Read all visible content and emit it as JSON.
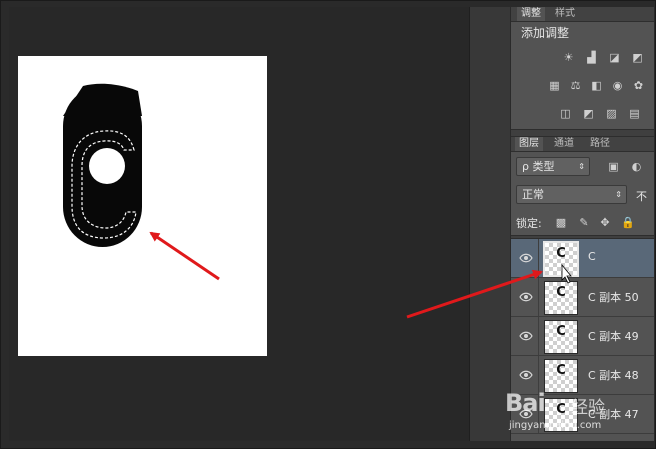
{
  "panels": {
    "adjust_tabs": [
      "调整",
      "样式"
    ],
    "adjust_title": "添加调整",
    "adjust_icons": [
      "brightness-icon",
      "levels-icon",
      "curves-icon",
      "exposure-icon",
      "vibrance-icon",
      "color-balance-icon",
      "black-white-icon",
      "photo-filter-icon",
      "channel-mixer-icon",
      "color-lookup-icon",
      "invert-icon",
      "posterize-icon",
      "threshold-icon",
      "gradient-map-icon"
    ],
    "layer_tabs": [
      "图层",
      "通道",
      "路径"
    ],
    "filter_label": "ρ 类型",
    "blend_mode": "正常",
    "opacity_label": "不",
    "lock_label": "锁定:",
    "lock_icons": [
      "lock-transparent-icon",
      "lock-paint-icon",
      "lock-move-icon",
      "lock-all-icon"
    ]
  },
  "layers": [
    {
      "name": "C",
      "thumb": "C",
      "selected": true
    },
    {
      "name": "C 副本 50",
      "thumb": "C",
      "selected": false
    },
    {
      "name": "C 副本 49",
      "thumb": "C",
      "selected": false
    },
    {
      "name": "C 副本 48",
      "thumb": "C",
      "selected": false
    },
    {
      "name": "C 副本 47",
      "thumb": "C",
      "selected": false
    }
  ],
  "colors": {
    "arrow": "#e0191b",
    "panel": "#535353",
    "selected_layer": "#596878"
  },
  "watermark": {
    "brand": "Bai",
    "suffix": "经验",
    "url": "jingyan.baidu.com"
  }
}
